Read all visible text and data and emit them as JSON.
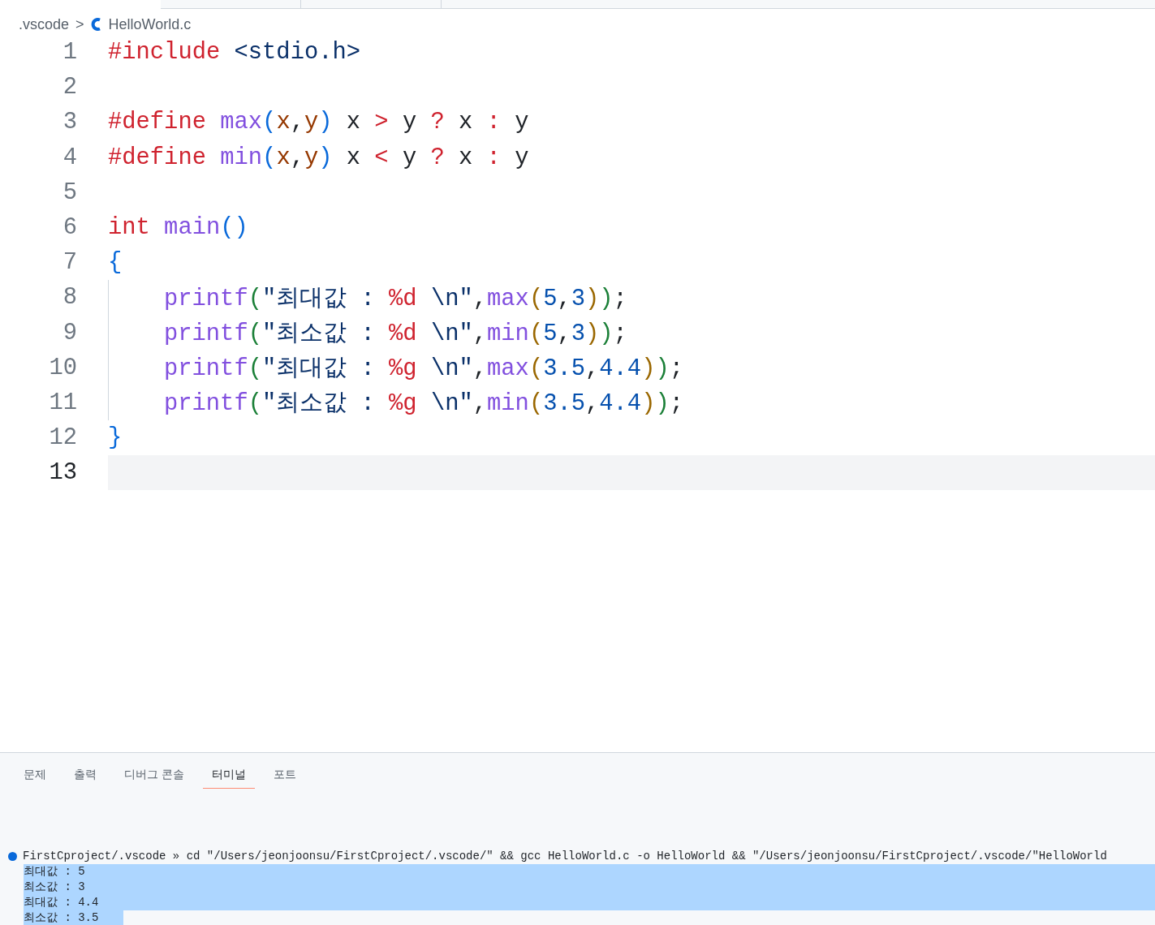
{
  "breadcrumb": {
    "folder": ".vscode",
    "separator": ">",
    "file": "HelloWorld.c"
  },
  "editor": {
    "lines": [
      {
        "number": "1",
        "current": false,
        "guide": false,
        "tokens": [
          {
            "t": "#include",
            "kind": "keyword"
          },
          {
            "t": " <stdio.h>",
            "kind": "string"
          }
        ]
      },
      {
        "number": "2",
        "current": false,
        "guide": false
      },
      {
        "number": "3",
        "current": false,
        "guide": false,
        "tokens": [
          {
            "t": "#define",
            "kind": "keyword"
          },
          {
            "t": " max",
            "kind": "function"
          },
          {
            "t": "(",
            "kind": "bracket1"
          },
          {
            "t": "x",
            "kind": "param"
          },
          {
            "t": ",",
            "kind": "plain"
          },
          {
            "t": "y",
            "kind": "param"
          },
          {
            "t": ")",
            "kind": "bracket1"
          },
          {
            "t": " x",
            "kind": "plain"
          },
          {
            "t": " >",
            "kind": "keyword"
          },
          {
            "t": " y",
            "kind": "plain"
          },
          {
            "t": " ?",
            "kind": "keyword"
          },
          {
            "t": " x",
            "kind": "plain"
          },
          {
            "t": " :",
            "kind": "keyword"
          },
          {
            "t": " y",
            "kind": "plain"
          }
        ]
      },
      {
        "number": "4",
        "current": false,
        "guide": false,
        "tokens": [
          {
            "t": "#define",
            "kind": "keyword"
          },
          {
            "t": " min",
            "kind": "function"
          },
          {
            "t": "(",
            "kind": "bracket1"
          },
          {
            "t": "x",
            "kind": "param"
          },
          {
            "t": ",",
            "kind": "plain"
          },
          {
            "t": "y",
            "kind": "param"
          },
          {
            "t": ")",
            "kind": "bracket1"
          },
          {
            "t": " x",
            "kind": "plain"
          },
          {
            "t": " <",
            "kind": "keyword"
          },
          {
            "t": " y",
            "kind": "plain"
          },
          {
            "t": " ?",
            "kind": "keyword"
          },
          {
            "t": " x",
            "kind": "plain"
          },
          {
            "t": " :",
            "kind": "keyword"
          },
          {
            "t": " y",
            "kind": "plain"
          }
        ]
      },
      {
        "number": "5",
        "current": false,
        "guide": false
      },
      {
        "number": "6",
        "current": false,
        "guide": false,
        "tokens": [
          {
            "t": "int",
            "kind": "keyword"
          },
          {
            "t": " main",
            "kind": "function"
          },
          {
            "t": "()",
            "kind": "bracket1"
          }
        ]
      },
      {
        "number": "7",
        "current": false,
        "guide": false,
        "tokens": [
          {
            "t": "{",
            "kind": "bracket1"
          }
        ]
      },
      {
        "number": "8",
        "current": false,
        "guide": true,
        "tokens": [
          {
            "t": "printf",
            "kind": "function"
          },
          {
            "t": "(",
            "kind": "bracket2"
          },
          {
            "t": "\"최대값 :",
            "kind": "string"
          },
          {
            "t": " %d",
            "kind": "keyword"
          },
          {
            "t": " \\n\"",
            "kind": "string"
          },
          {
            "t": ",",
            "kind": "plain"
          },
          {
            "t": "max",
            "kind": "function"
          },
          {
            "t": "(",
            "kind": "bracket3"
          },
          {
            "t": "5",
            "kind": "number"
          },
          {
            "t": ",",
            "kind": "plain"
          },
          {
            "t": "3",
            "kind": "number"
          },
          {
            "t": ")",
            "kind": "bracket3"
          },
          {
            "t": ")",
            "kind": "bracket2"
          },
          {
            "t": ";",
            "kind": "plain"
          }
        ]
      },
      {
        "number": "9",
        "current": false,
        "guide": true,
        "tokens": [
          {
            "t": "printf",
            "kind": "function"
          },
          {
            "t": "(",
            "kind": "bracket2"
          },
          {
            "t": "\"최소값 :",
            "kind": "string"
          },
          {
            "t": " %d",
            "kind": "keyword"
          },
          {
            "t": " \\n\"",
            "kind": "string"
          },
          {
            "t": ",",
            "kind": "plain"
          },
          {
            "t": "min",
            "kind": "function"
          },
          {
            "t": "(",
            "kind": "bracket3"
          },
          {
            "t": "5",
            "kind": "number"
          },
          {
            "t": ",",
            "kind": "plain"
          },
          {
            "t": "3",
            "kind": "number"
          },
          {
            "t": ")",
            "kind": "bracket3"
          },
          {
            "t": ")",
            "kind": "bracket2"
          },
          {
            "t": ";",
            "kind": "plain"
          }
        ]
      },
      {
        "number": "10",
        "current": false,
        "guide": true,
        "tokens": [
          {
            "t": "printf",
            "kind": "function"
          },
          {
            "t": "(",
            "kind": "bracket2"
          },
          {
            "t": "\"최대값 :",
            "kind": "string"
          },
          {
            "t": " %g",
            "kind": "keyword"
          },
          {
            "t": " \\n\"",
            "kind": "string"
          },
          {
            "t": ",",
            "kind": "plain"
          },
          {
            "t": "max",
            "kind": "function"
          },
          {
            "t": "(",
            "kind": "bracket3"
          },
          {
            "t": "3.5",
            "kind": "number"
          },
          {
            "t": ",",
            "kind": "plain"
          },
          {
            "t": "4.4",
            "kind": "number"
          },
          {
            "t": ")",
            "kind": "bracket3"
          },
          {
            "t": ")",
            "kind": "bracket2"
          },
          {
            "t": ";",
            "kind": "plain"
          }
        ]
      },
      {
        "number": "11",
        "current": false,
        "guide": true,
        "tokens": [
          {
            "t": "printf",
            "kind": "function"
          },
          {
            "t": "(",
            "kind": "bracket2"
          },
          {
            "t": "\"최소값 :",
            "kind": "string"
          },
          {
            "t": " %g",
            "kind": "keyword"
          },
          {
            "t": " \\n\"",
            "kind": "string"
          },
          {
            "t": ",",
            "kind": "plain"
          },
          {
            "t": "min",
            "kind": "function"
          },
          {
            "t": "(",
            "kind": "bracket3"
          },
          {
            "t": "3.5",
            "kind": "number"
          },
          {
            "t": ",",
            "kind": "plain"
          },
          {
            "t": "4.4",
            "kind": "number"
          },
          {
            "t": ")",
            "kind": "bracket3"
          },
          {
            "t": ")",
            "kind": "bracket2"
          },
          {
            "t": ";",
            "kind": "plain"
          }
        ]
      },
      {
        "number": "12",
        "current": false,
        "guide": false,
        "tokens": [
          {
            "t": "}",
            "kind": "bracket1"
          }
        ]
      },
      {
        "number": "13",
        "current": true,
        "guide": false
      }
    ]
  },
  "panel": {
    "tabs": [
      {
        "label": "문제",
        "selected": false
      },
      {
        "label": "출력",
        "selected": false
      },
      {
        "label": "디버그 콘솔",
        "selected": false
      },
      {
        "label": "터미널",
        "selected": true
      },
      {
        "label": "포트",
        "selected": false
      }
    ]
  },
  "terminal": {
    "prompt": "FirstCproject/.vscode »",
    "command": "cd \"/Users/jeonjoonsu/FirstCproject/.vscode/\" && gcc HelloWorld.c -o HelloWorld && \"/Users/jeonjoonsu/FirstCproject/.vscode/\"HelloWorld",
    "output": [
      {
        "text": "최대값 : 5",
        "selected": true
      },
      {
        "text": "최소값 : 3",
        "selected": true
      },
      {
        "text": "최대값 : 4.4",
        "selected": true
      },
      {
        "text": "최소값 : 3.5",
        "selected": true
      }
    ]
  }
}
